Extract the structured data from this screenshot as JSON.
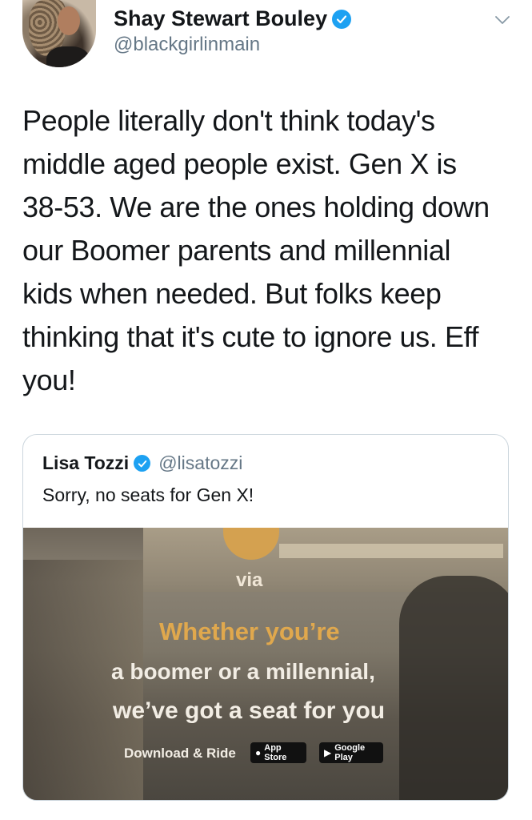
{
  "author": {
    "display_name": "Shay Stewart Bouley",
    "handle": "@blackgirlinmain"
  },
  "tweet": {
    "lines": [
      "People literally don't think today's",
      "middle aged people exist. Gen X is",
      "38-53. We are the ones holding down",
      "our Boomer parents and millennial",
      "kids when needed. But folks keep",
      "thinking that it's cute to ignore us. Eff",
      "you!"
    ]
  },
  "quoted_tweet": {
    "display_name": "Lisa Tozzi",
    "handle": "@lisatozzi",
    "text": "Sorry, no seats for Gen X!",
    "image": {
      "brand": "via",
      "line1": "Whether you’re",
      "line2": "a boomer or a millennial,",
      "line3": "we’ve got a seat for you",
      "cta": "Download & Ride",
      "app_store_label": "App Store",
      "google_play_label": "Google Play"
    }
  },
  "colors": {
    "verified": "#1da1f2",
    "handle": "#657786",
    "border": "#ccd6dd",
    "ad_orange": "#e0a84d"
  }
}
